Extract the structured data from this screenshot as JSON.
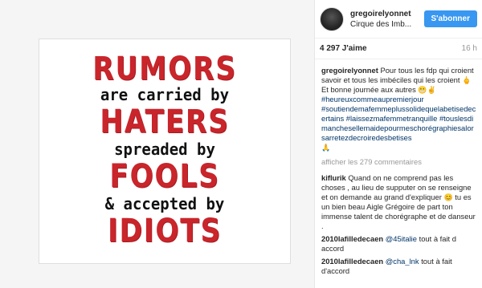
{
  "post": {
    "poster_lines": [
      {
        "text": "RUMORS",
        "style": "big"
      },
      {
        "text": "are carried by",
        "style": "small"
      },
      {
        "text": "HATERS",
        "style": "big"
      },
      {
        "text": "spreaded by",
        "style": "small"
      },
      {
        "text": "FOOLS",
        "style": "big"
      },
      {
        "text": "& accepted by",
        "style": "small"
      },
      {
        "text": "IDIOTS",
        "style": "big"
      }
    ]
  },
  "header": {
    "username": "gregoirelyonnet",
    "location": "Cirque des Imb...",
    "follow_label": "S'abonner"
  },
  "stats": {
    "likes": "4 297 J'aime",
    "time": "16 h"
  },
  "caption": {
    "user": "gregoirelyonnet",
    "text1": "Pour tous les fdp qui croient savoir et tous les imbéciles qui les croient",
    "emoji1": "🖕",
    "text2": "Et bonne journée aux autres",
    "emoji2": "😬✌",
    "hashtags": [
      "#heureuxcommeaupremierjour",
      "#soutiendemafemmeplussolidequelabetisedecertains",
      "#laissezmafemmetranquille",
      "#touslesdimanchesellemaidepourmeschorégraphiesalorsarretezdecroiredesbetises"
    ],
    "emoji3": "🙏"
  },
  "view_all_label": "afficher les 279 commentaires",
  "comments": [
    {
      "user": "kiflurik",
      "text": "Quand on ne comprend pas les choses , au lieu de supputer on se renseigne et on demande au grand d'expliquer",
      "emoji": "😊",
      "text2": "tu es un bien beau Aigle Grégoire de part ton immense talent de chorégraphe et de danseur ."
    },
    {
      "user": "2010lafilledecaen",
      "mention": "@45italie",
      "text": "tout à fait d accord"
    },
    {
      "user": "2010lafilledecaen",
      "mention": "@cha_lnk",
      "text": "tout à fait d'accord"
    }
  ],
  "colors": {
    "poster_red": "#c9252b",
    "follow_blue": "#3897f0",
    "hashtag_blue": "#003569"
  },
  "icons": {
    "avatar": "avatar"
  }
}
